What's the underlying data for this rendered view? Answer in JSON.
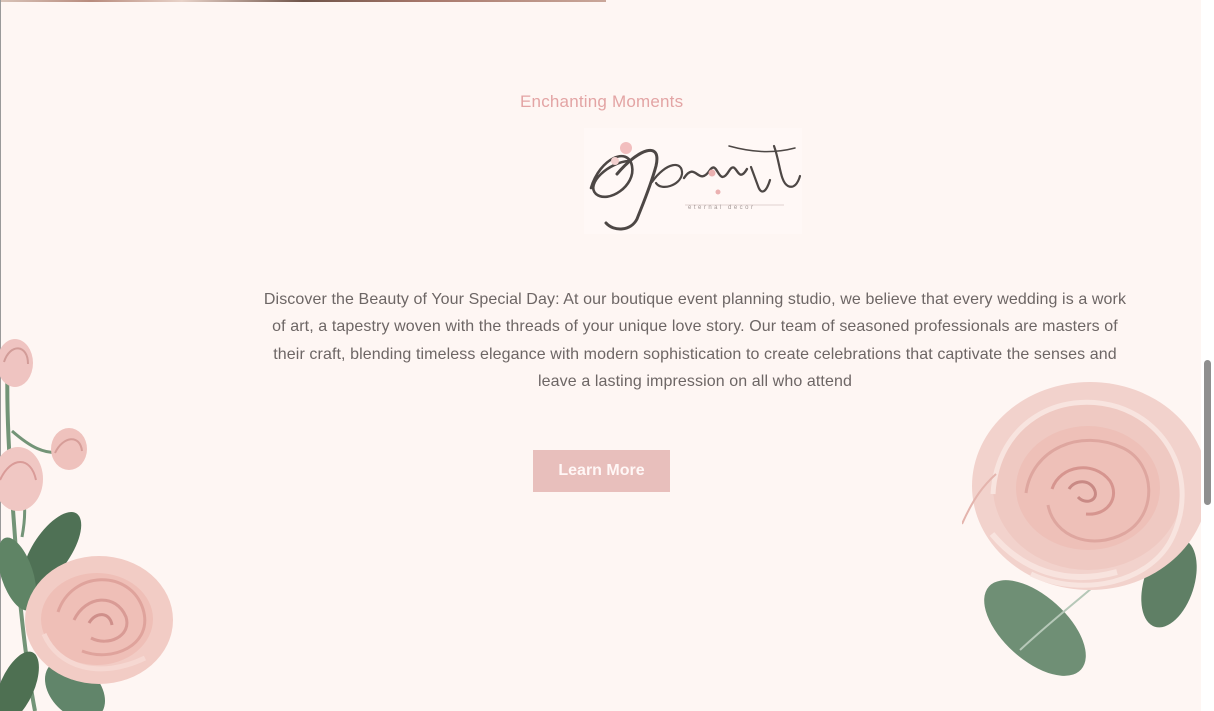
{
  "hero": {
    "eyebrow": "Enchanting Moments",
    "logo": {
      "wordmark": "Jewit",
      "tagline": "eternal decor",
      "icon": "calligraphy-logo"
    },
    "description": "Discover the Beauty of Your Special Day: At our boutique event planning studio, we believe that every wedding is a work of art, a tapestry woven with the threads of your unique love story. Our team of seasoned professionals are masters of their craft, blending timeless elegance with modern sophistication to create celebrations that captivate the senses and leave a lasting impression on all who attend",
    "cta_label": "Learn More"
  },
  "decorations": {
    "left": "rose-bouquet-icon",
    "right": "rose-blossom-icon"
  },
  "colors": {
    "background": "#fef6f3",
    "accent": "#e3a4a4",
    "button": "#e8bfbc",
    "body_text": "#6d6665"
  }
}
